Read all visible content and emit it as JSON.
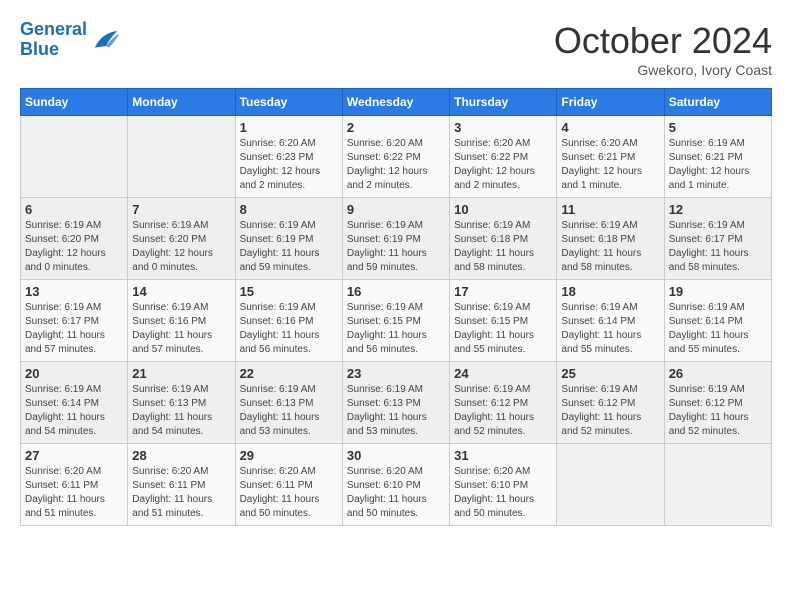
{
  "header": {
    "logo_line1": "General",
    "logo_line2": "Blue",
    "month": "October 2024",
    "location": "Gwekoro, Ivory Coast"
  },
  "weekdays": [
    "Sunday",
    "Monday",
    "Tuesday",
    "Wednesday",
    "Thursday",
    "Friday",
    "Saturday"
  ],
  "weeks": [
    [
      {
        "day": "",
        "info": ""
      },
      {
        "day": "",
        "info": ""
      },
      {
        "day": "1",
        "info": "Sunrise: 6:20 AM\nSunset: 6:23 PM\nDaylight: 12 hours and 2 minutes."
      },
      {
        "day": "2",
        "info": "Sunrise: 6:20 AM\nSunset: 6:22 PM\nDaylight: 12 hours and 2 minutes."
      },
      {
        "day": "3",
        "info": "Sunrise: 6:20 AM\nSunset: 6:22 PM\nDaylight: 12 hours and 2 minutes."
      },
      {
        "day": "4",
        "info": "Sunrise: 6:20 AM\nSunset: 6:21 PM\nDaylight: 12 hours and 1 minute."
      },
      {
        "day": "5",
        "info": "Sunrise: 6:19 AM\nSunset: 6:21 PM\nDaylight: 12 hours and 1 minute."
      }
    ],
    [
      {
        "day": "6",
        "info": "Sunrise: 6:19 AM\nSunset: 6:20 PM\nDaylight: 12 hours and 0 minutes."
      },
      {
        "day": "7",
        "info": "Sunrise: 6:19 AM\nSunset: 6:20 PM\nDaylight: 12 hours and 0 minutes."
      },
      {
        "day": "8",
        "info": "Sunrise: 6:19 AM\nSunset: 6:19 PM\nDaylight: 11 hours and 59 minutes."
      },
      {
        "day": "9",
        "info": "Sunrise: 6:19 AM\nSunset: 6:19 PM\nDaylight: 11 hours and 59 minutes."
      },
      {
        "day": "10",
        "info": "Sunrise: 6:19 AM\nSunset: 6:18 PM\nDaylight: 11 hours and 58 minutes."
      },
      {
        "day": "11",
        "info": "Sunrise: 6:19 AM\nSunset: 6:18 PM\nDaylight: 11 hours and 58 minutes."
      },
      {
        "day": "12",
        "info": "Sunrise: 6:19 AM\nSunset: 6:17 PM\nDaylight: 11 hours and 58 minutes."
      }
    ],
    [
      {
        "day": "13",
        "info": "Sunrise: 6:19 AM\nSunset: 6:17 PM\nDaylight: 11 hours and 57 minutes."
      },
      {
        "day": "14",
        "info": "Sunrise: 6:19 AM\nSunset: 6:16 PM\nDaylight: 11 hours and 57 minutes."
      },
      {
        "day": "15",
        "info": "Sunrise: 6:19 AM\nSunset: 6:16 PM\nDaylight: 11 hours and 56 minutes."
      },
      {
        "day": "16",
        "info": "Sunrise: 6:19 AM\nSunset: 6:15 PM\nDaylight: 11 hours and 56 minutes."
      },
      {
        "day": "17",
        "info": "Sunrise: 6:19 AM\nSunset: 6:15 PM\nDaylight: 11 hours and 55 minutes."
      },
      {
        "day": "18",
        "info": "Sunrise: 6:19 AM\nSunset: 6:14 PM\nDaylight: 11 hours and 55 minutes."
      },
      {
        "day": "19",
        "info": "Sunrise: 6:19 AM\nSunset: 6:14 PM\nDaylight: 11 hours and 55 minutes."
      }
    ],
    [
      {
        "day": "20",
        "info": "Sunrise: 6:19 AM\nSunset: 6:14 PM\nDaylight: 11 hours and 54 minutes."
      },
      {
        "day": "21",
        "info": "Sunrise: 6:19 AM\nSunset: 6:13 PM\nDaylight: 11 hours and 54 minutes."
      },
      {
        "day": "22",
        "info": "Sunrise: 6:19 AM\nSunset: 6:13 PM\nDaylight: 11 hours and 53 minutes."
      },
      {
        "day": "23",
        "info": "Sunrise: 6:19 AM\nSunset: 6:13 PM\nDaylight: 11 hours and 53 minutes."
      },
      {
        "day": "24",
        "info": "Sunrise: 6:19 AM\nSunset: 6:12 PM\nDaylight: 11 hours and 52 minutes."
      },
      {
        "day": "25",
        "info": "Sunrise: 6:19 AM\nSunset: 6:12 PM\nDaylight: 11 hours and 52 minutes."
      },
      {
        "day": "26",
        "info": "Sunrise: 6:19 AM\nSunset: 6:12 PM\nDaylight: 11 hours and 52 minutes."
      }
    ],
    [
      {
        "day": "27",
        "info": "Sunrise: 6:20 AM\nSunset: 6:11 PM\nDaylight: 11 hours and 51 minutes."
      },
      {
        "day": "28",
        "info": "Sunrise: 6:20 AM\nSunset: 6:11 PM\nDaylight: 11 hours and 51 minutes."
      },
      {
        "day": "29",
        "info": "Sunrise: 6:20 AM\nSunset: 6:11 PM\nDaylight: 11 hours and 50 minutes."
      },
      {
        "day": "30",
        "info": "Sunrise: 6:20 AM\nSunset: 6:10 PM\nDaylight: 11 hours and 50 minutes."
      },
      {
        "day": "31",
        "info": "Sunrise: 6:20 AM\nSunset: 6:10 PM\nDaylight: 11 hours and 50 minutes."
      },
      {
        "day": "",
        "info": ""
      },
      {
        "day": "",
        "info": ""
      }
    ]
  ]
}
